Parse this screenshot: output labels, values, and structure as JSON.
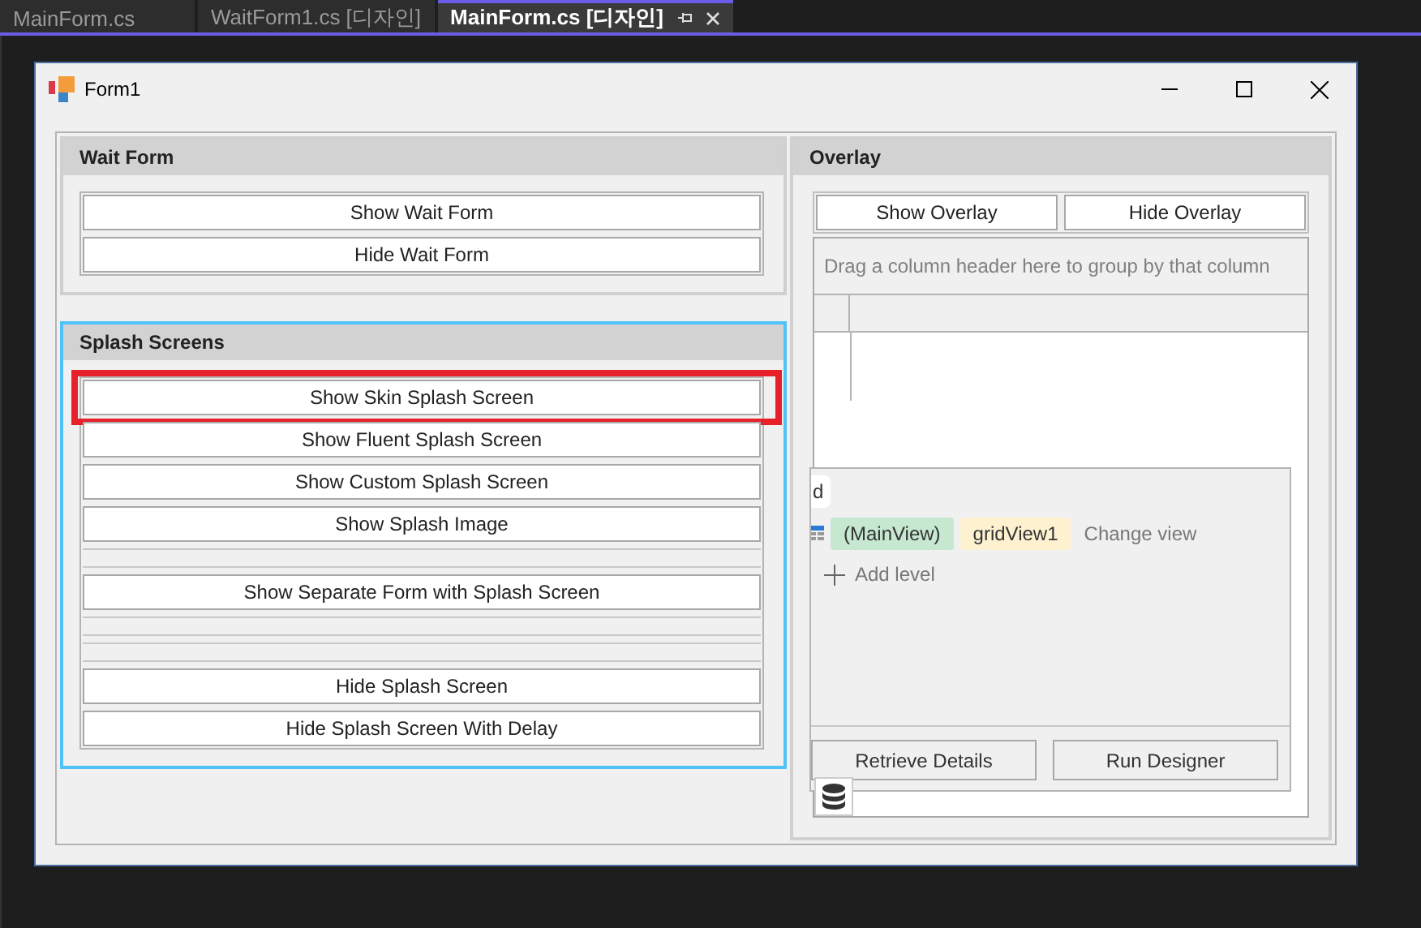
{
  "tabs": [
    {
      "label": "MainForm.cs",
      "selected": false
    },
    {
      "label": "WaitForm1.cs [디자인]",
      "selected": false
    },
    {
      "label": "MainForm.cs [디자인]",
      "selected": true
    }
  ],
  "form": {
    "title": "Form1"
  },
  "wait_form": {
    "title": "Wait Form",
    "buttons": [
      "Show Wait Form",
      "Hide Wait Form"
    ]
  },
  "splash_screens": {
    "title": "Splash Screens",
    "focused": true,
    "items": [
      {
        "kind": "button",
        "label": "Show Skin Splash Screen",
        "highlighted": true
      },
      {
        "kind": "button",
        "label": "Show Fluent Splash Screen",
        "highlighted": false
      },
      {
        "kind": "button",
        "label": "Show Custom Splash Screen",
        "highlighted": false
      },
      {
        "kind": "button",
        "label": "Show Splash Image",
        "highlighted": false
      },
      {
        "kind": "spacer"
      },
      {
        "kind": "button",
        "label": "Show Separate Form with Splash Screen",
        "highlighted": false
      },
      {
        "kind": "spacer"
      },
      {
        "kind": "spacer"
      },
      {
        "kind": "button",
        "label": "Hide Splash Screen",
        "highlighted": false
      },
      {
        "kind": "button",
        "label": "Hide Splash Screen With Delay",
        "highlighted": false
      }
    ]
  },
  "overlay": {
    "title": "Overlay",
    "buttons": [
      "Show Overlay",
      "Hide Overlay"
    ],
    "grid": {
      "group_panel_hint": "Drag a column header here to group by that column",
      "level_designer": {
        "tab_stub": "d",
        "levels": [
          {
            "label": "(MainView)",
            "color": "#c6e8d0"
          },
          {
            "label": "gridView1",
            "color": "#fdf1d0"
          }
        ],
        "change_view": "Change view",
        "add_level": "Add level",
        "buttons": [
          "Retrieve Details",
          "Run Designer"
        ]
      }
    }
  }
}
